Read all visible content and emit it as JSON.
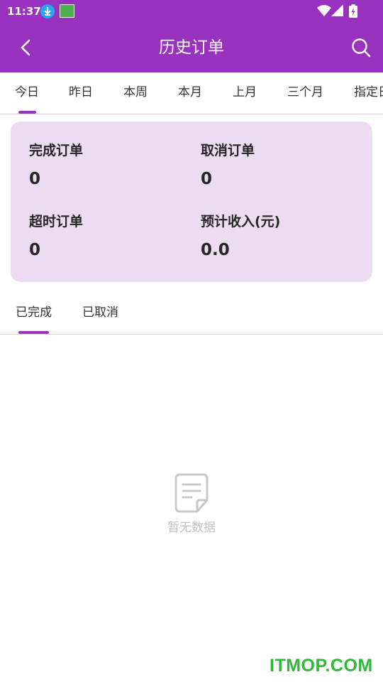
{
  "status_bar": {
    "time": "11:37",
    "icons": [
      "download-icon",
      "app-notification-icon",
      "wifi-icon",
      "signal-icon",
      "battery-icon"
    ]
  },
  "header": {
    "title": "历史订单",
    "back_icon": "chevron-left-icon",
    "search_icon": "search-icon"
  },
  "period_tabs": {
    "items": [
      {
        "label": "今日"
      },
      {
        "label": "昨日"
      },
      {
        "label": "本周"
      },
      {
        "label": "本月"
      },
      {
        "label": "上月"
      },
      {
        "label": "三个月"
      },
      {
        "label": "指定日"
      }
    ],
    "selected": "今日"
  },
  "stats": {
    "completed": {
      "label": "完成订单",
      "value": "0"
    },
    "cancelled": {
      "label": "取消订单",
      "value": "0"
    },
    "overtime": {
      "label": "超时订单",
      "value": "0"
    },
    "income": {
      "label": "预计收入(元)",
      "value": "0.0"
    }
  },
  "status_tabs": {
    "items": [
      {
        "label": "已完成"
      },
      {
        "label": "已取消"
      }
    ],
    "selected": "已完成"
  },
  "empty_state": {
    "icon": "document-icon",
    "text": "暂无数据"
  },
  "watermark": "ITMOP.COM",
  "colors": {
    "primary": "#9932bf",
    "card_bg": "#ecdbf1",
    "empty_text": "#c2c2c2",
    "watermark": "#2fb83a"
  }
}
